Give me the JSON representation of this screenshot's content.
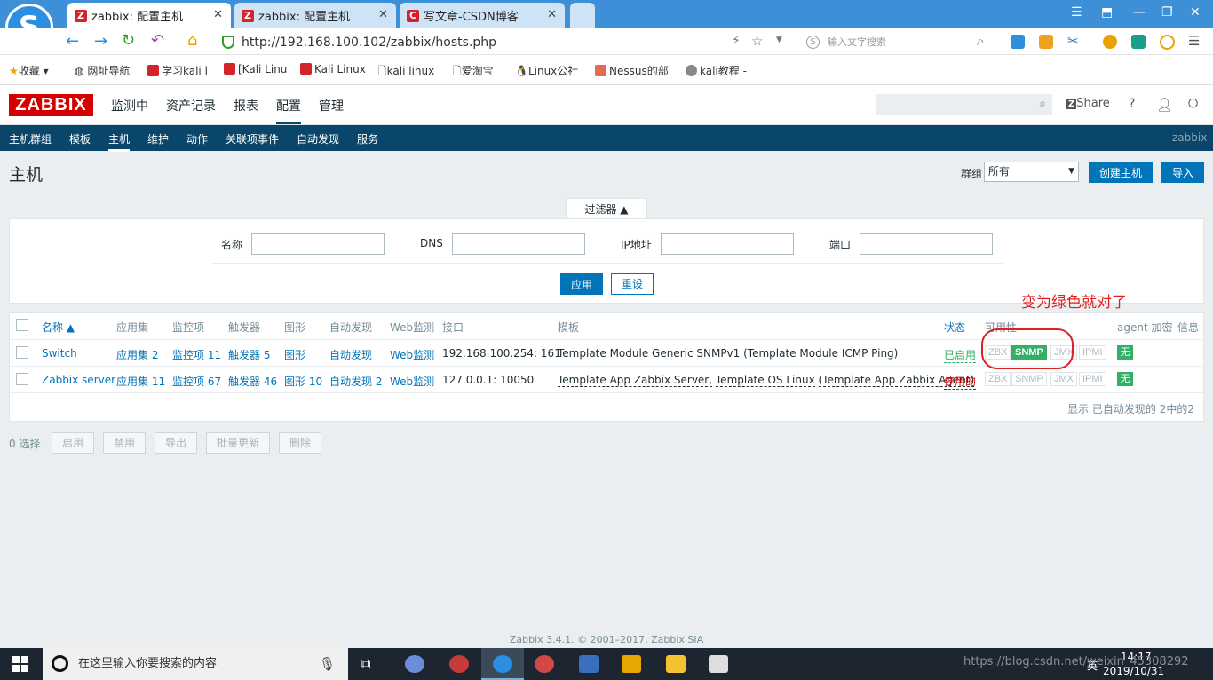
{
  "browser": {
    "tabs": [
      {
        "title": "zabbix: 配置主机",
        "icon": "Z",
        "active": true
      },
      {
        "title": "zabbix: 配置主机",
        "icon": "Z",
        "active": false
      },
      {
        "title": "写文章-CSDN博客",
        "icon": "C",
        "active": false
      }
    ],
    "url": "http://192.168.100.102/zabbix/hosts.php",
    "search_placeholder": "输入文字搜索",
    "bookmarks": [
      "收藏",
      "网址导航",
      "学习kali l",
      "[Kali Linu",
      "Kali Linux",
      "kali linux",
      "爱淘宝",
      "Linux公社",
      "Nessus的部",
      "kali教程 -"
    ]
  },
  "header": {
    "logo": "ZABBIX",
    "menu": [
      "监测中",
      "资产记录",
      "报表",
      "配置",
      "管理"
    ],
    "share": "Share",
    "help": "?"
  },
  "subnav": {
    "items": [
      "主机群组",
      "模板",
      "主机",
      "维护",
      "动作",
      "关联项事件",
      "自动发现",
      "服务"
    ],
    "user": "zabbix"
  },
  "page": {
    "title": "主机",
    "group_label": "群组",
    "group_value": "所有",
    "create_button": "创建主机",
    "import_button": "导入"
  },
  "filter": {
    "tab_label": "过滤器 ▲",
    "name_label": "名称",
    "dns_label": "DNS",
    "ip_label": "IP地址",
    "port_label": "端口",
    "apply_button": "应用",
    "reset_button": "重设"
  },
  "annotation": "变为绿色就对了",
  "table": {
    "headers": [
      "名称 ▲",
      "应用集",
      "监控项",
      "触发器",
      "图形",
      "自动发现",
      "Web监测",
      "接口",
      "模板",
      "状态",
      "可用性",
      "agent 加密",
      "信息"
    ],
    "rows": [
      {
        "name": "Switch",
        "apps": "应用集 2",
        "items": "监控项 11",
        "triggers": "触发器 5",
        "graphs": "图形",
        "discovery": "自动发现",
        "web": "Web监测",
        "interface": "192.168.100.254: 161",
        "template_1": "Template Module Generic SNMPv1",
        "template_2": "(Template Module ICMP Ping)",
        "status": "已启用",
        "status_color": "#34af67",
        "availability": [
          {
            "label": "ZBX",
            "on": false
          },
          {
            "label": "SNMP",
            "on": true
          },
          {
            "label": "JMX",
            "on": false
          },
          {
            "label": "IPMI",
            "on": false
          }
        ],
        "encryption": "无"
      },
      {
        "name": "Zabbix server",
        "apps": "应用集 11",
        "items": "监控项 67",
        "triggers": "触发器 46",
        "graphs": "图形 10",
        "discovery": "自动发现 2",
        "web": "Web监测",
        "interface": "127.0.0.1: 10050",
        "template_1": "Template App Zabbix Server,",
        "template_2": "Template OS Linux",
        "template_3": "(Template App Zabbix Agent)",
        "status": "停用的",
        "status_color": "#dc0000",
        "availability": [
          {
            "label": "ZBX",
            "on": false
          },
          {
            "label": "SNMP",
            "on": false
          },
          {
            "label": "JMX",
            "on": false
          },
          {
            "label": "IPMI",
            "on": false
          }
        ],
        "encryption": "无"
      }
    ],
    "summary": "显示 已自动发现的 2中的2"
  },
  "mass": {
    "selected": "0 选择",
    "buttons": [
      "启用",
      "禁用",
      "导出",
      "批量更新",
      "删除"
    ]
  },
  "footer": "Zabbix 3.4.1. © 2001–2017, Zabbix SIA",
  "taskbar": {
    "search_placeholder": "在这里输入你要搜索的内容",
    "time": "14:17",
    "date": "2019/10/31",
    "ime": "英",
    "watermark": "https://blog.csdn.net/weixin_45308292"
  }
}
